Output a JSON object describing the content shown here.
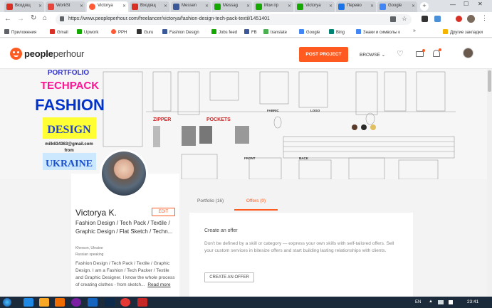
{
  "browser": {
    "tabs": [
      {
        "label": "Входящ",
        "color": "#d93025"
      },
      {
        "label": "WorkSt",
        "color": "#e8453c"
      },
      {
        "label": "Victorya",
        "color": "#ff5a36",
        "active": true
      },
      {
        "label": "Входящ",
        "color": "#d93025"
      },
      {
        "label": "Messen",
        "color": "#3b5998"
      },
      {
        "label": "Messag",
        "color": "#14a800"
      },
      {
        "label": "Мои пр",
        "color": "#14a800"
      },
      {
        "label": "Victorya",
        "color": "#14a800"
      },
      {
        "label": "Перево",
        "color": "#1a73e8"
      },
      {
        "label": "Google",
        "color": "#4285f4"
      }
    ],
    "url": "https://www.peopleperhour.com/freelancer/victorya/fashion-design-tech-pack-textil/1451401",
    "bookmarks": [
      {
        "label": "Приложения",
        "color": "#5f6368"
      },
      {
        "label": "Gmail",
        "color": "#d93025"
      },
      {
        "label": "Upwork",
        "color": "#14a800"
      },
      {
        "label": "PPH",
        "color": "#ff5a36"
      },
      {
        "label": "Guru",
        "color": "#333333"
      },
      {
        "label": "Fashion Design",
        "color": "#3b5998"
      },
      {
        "label": "Jobs feed",
        "color": "#14a800"
      },
      {
        "label": "FB",
        "color": "#3b5998"
      },
      {
        "label": "translate",
        "color": "#4caf50"
      },
      {
        "label": "Google",
        "color": "#4285f4"
      },
      {
        "label": "Bing",
        "color": "#008373"
      },
      {
        "label": "Знаки и символы к",
        "color": "#4285f4"
      },
      {
        "label": "Другие закладки",
        "color": "#f4b400"
      }
    ]
  },
  "site": {
    "logo_text_bold": "people",
    "logo_text_light": "perhour",
    "post_project": "POST PROJECT",
    "browse": "BROWSE",
    "brand_color": "#ff5a1f"
  },
  "cover": {
    "lines": [
      "PORTFOLIO",
      "TECHPACK",
      "FASHION",
      "DESIGN",
      "milk634363@gmail.com",
      "from",
      "UKRAINE"
    ],
    "labels": [
      "ZIPPER",
      "POCKETS",
      "FABRIC",
      "LOGO",
      "FRONT",
      "BACK"
    ]
  },
  "profile": {
    "name": "Victorya K.",
    "edit": "EDIT",
    "headline": "Fashion Design / Tech Pack / Textile / Graphic Design / Flat Sketch / Techn...",
    "location": "Kherson, Ukraine",
    "language": "Russian speaking",
    "bio": "Fashion Design / Tech Pack / Textile / Graphic Design. I am a Fashion / Tech Packer / Textile and Graphic Designer. I know the whole process of creating clothes - from sketch...",
    "read_more": "Read more"
  },
  "tabs": {
    "portfolio": "Portfolio (16)",
    "offers": "Offers (0)"
  },
  "offers": {
    "title": "Create an offer",
    "body": "Don't be defined by a skill or category — express your own skills with self-tailored offers. Sell your custom services in bitesize offers and start building lasting relationships with clients.",
    "button": "CREATE AN OFFER"
  },
  "taskbar": {
    "lang": "EN",
    "time": "23:41"
  }
}
